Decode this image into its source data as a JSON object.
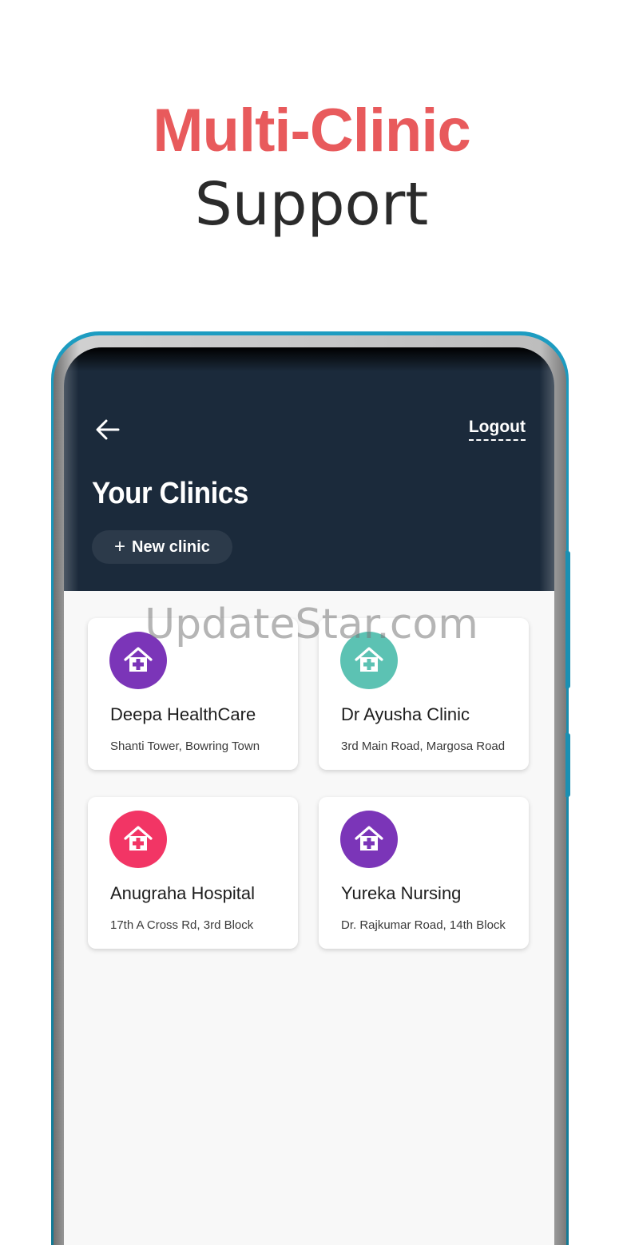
{
  "headline": {
    "line1": "Multi-Clinic",
    "line2": "Support"
  },
  "header": {
    "back_icon": "arrow-left-icon",
    "logout_label": "Logout",
    "title": "Your Clinics",
    "new_clinic_label": "New clinic"
  },
  "clinics": [
    {
      "name": "Deepa HealthCare",
      "address": "Shanti Tower, Bowring Town",
      "icon": "clinic-house-icon",
      "color": "#7b35b8"
    },
    {
      "name": "Dr Ayusha Clinic",
      "address": "3rd Main Road, Margosa Road",
      "icon": "clinic-house-icon",
      "color": "#5cc2b3"
    },
    {
      "name": "Anugraha Hospital",
      "address": "17th A Cross Rd, 3rd Block",
      "icon": "clinic-house-icon",
      "color": "#f23565"
    },
    {
      "name": "Yureka Nursing",
      "address": "Dr. Rajkumar Road, 14th Block",
      "icon": "clinic-house-icon",
      "color": "#7b35b8"
    }
  ],
  "watermark": "UpdateStar.com",
  "colors": {
    "accent_red": "#e85a5c",
    "header_bg": "#1b2a3b"
  }
}
